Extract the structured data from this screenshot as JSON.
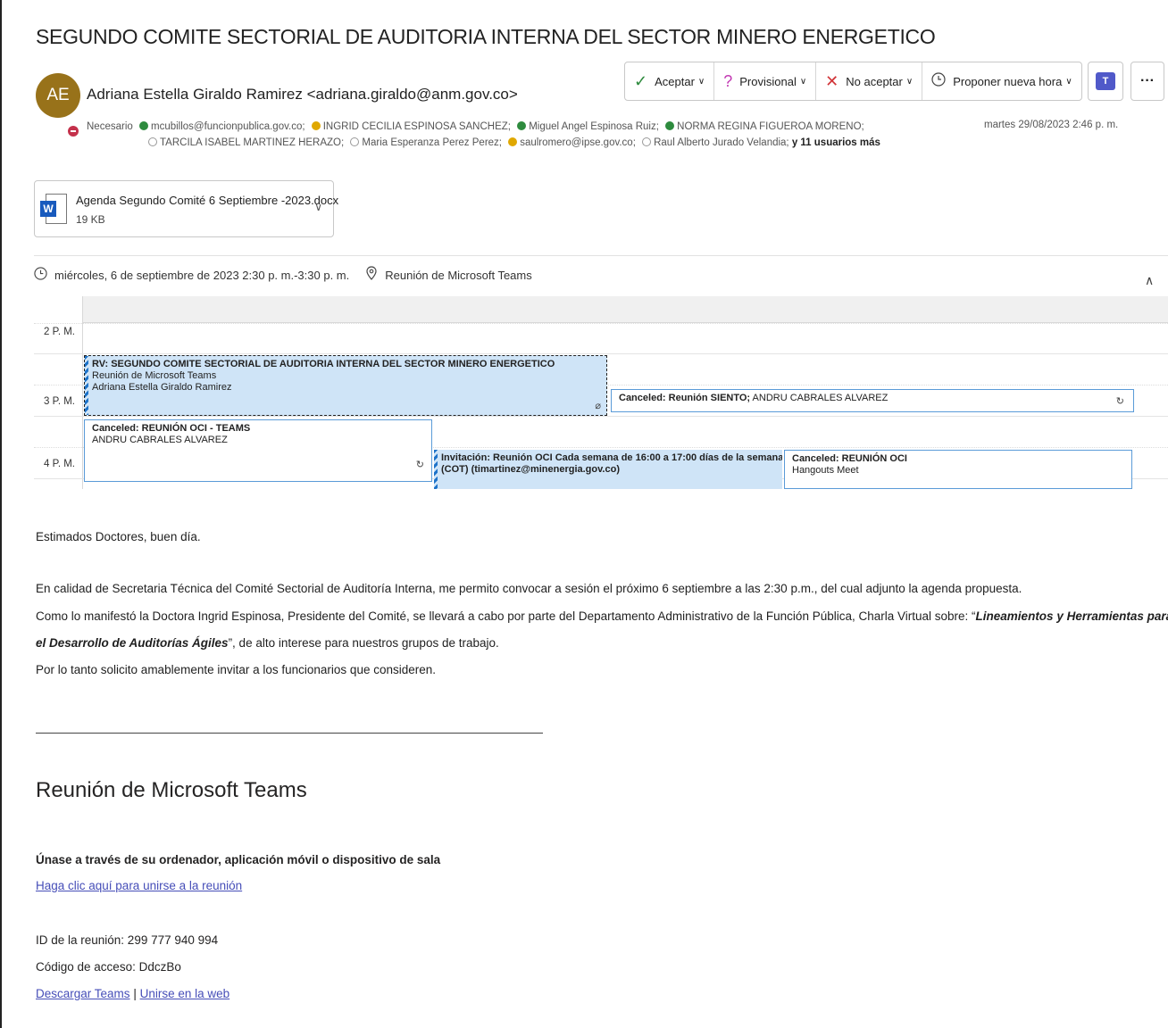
{
  "subject": "SEGUNDO COMITE SECTORIAL DE AUDITORIA INTERNA DEL SECTOR MINERO ENERGETICO",
  "sender": {
    "initials": "AE",
    "display": "Adriana Estella Giraldo Ramirez <adriana.giraldo@anm.gov.co>"
  },
  "toolbar": {
    "accept": "Aceptar",
    "tentative": "Provisional",
    "decline": "No aceptar",
    "propose": "Proponer nueva hora",
    "more": "···"
  },
  "recipients": {
    "label": "Necesario",
    "line1": [
      {
        "status": "accepted",
        "name": "mcubillos@funcionpublica.gov.co;"
      },
      {
        "status": "tentative",
        "name": "INGRID CECILIA ESPINOSA SANCHEZ;"
      },
      {
        "status": "accepted",
        "name": "Miguel Angel Espinosa Ruiz;"
      },
      {
        "status": "accepted",
        "name": "NORMA REGINA FIGUEROA MORENO;"
      }
    ],
    "line2": [
      {
        "status": "none",
        "name": "TARCILA ISABEL MARTINEZ HERAZO;"
      },
      {
        "status": "none",
        "name": "Maria Esperanza Perez Perez;"
      },
      {
        "status": "tentative",
        "name": "saulromero@ipse.gov.co;"
      },
      {
        "status": "none",
        "name": "Raul Alberto Jurado Velandia;"
      }
    ],
    "more": "y 11 usuarios más"
  },
  "sent_date": "martes 29/08/2023 2:46 p. m.",
  "attachment": {
    "name": "Agenda Segundo Comité 6 Septiembre -2023.docx",
    "size": "19 KB"
  },
  "meeting": {
    "when": "miércoles, 6 de septiembre de 2023 2:30 p. m.-3:30 p. m.",
    "where": "Reunión de Microsoft Teams"
  },
  "calendar": {
    "hours": [
      "2 P. M.",
      "3 P. M.",
      "4 P. M."
    ],
    "events": {
      "main": {
        "title": "RV: SEGUNDO COMITE SECTORIAL DE AUDITORIA INTERNA DEL SECTOR MINERO ENERGETICO",
        "line2": "Reunión de Microsoft Teams",
        "line3": "Adriana Estella Giraldo Ramirez"
      },
      "canceled1": {
        "title": "Canceled: Reunión SIENTO;",
        "rest": " ANDRU CABRALES ALVAREZ"
      },
      "canceled2": {
        "title": "Canceled: REUNIÓN OCI - TEAMS",
        "line2": "ANDRU CABRALES ALVAREZ"
      },
      "invitation": {
        "title": "Invitación: Reunión OCI Cada semana de 16:00 a 17:00 días de la semana",
        "line2": "(COT) (timartinez@minenergia.gov.co)"
      },
      "canceled3": {
        "title": "Canceled: REUNIÓN OCI",
        "line2": "Hangouts Meet"
      }
    }
  },
  "body": {
    "greeting": "Estimados Doctores, buen día.",
    "p1": "En calidad de Secretaria Técnica del  Comité Sectorial de Auditoría Interna, me permito convocar a sesión el próximo 6 septiembre a las 2:30 p.m., del cual adjunto la agenda propuesta.",
    "p2a": "Como lo manifestó la Doctora Ingrid Espinosa, Presidente del Comité, se llevará a cabo por parte del Departamento Administrativo de la Función Pública, Charla Virtual sobre: “",
    "p2b": "Lineamientos y Herramientas para",
    "p3a": "el Desarrollo de Auditorías Ágiles",
    "p3b": "”, de alto interese para nuestros grupos de trabajo.",
    "p4": "Por lo tanto solicito amablemente invitar a los funcionarios que consideren."
  },
  "teams": {
    "title": "Reunión de Microsoft Teams",
    "join_heading": "Únase a través de su ordenador, aplicación móvil o dispositivo de sala",
    "join_link": "Haga clic aquí para unirse a la reunión",
    "meeting_id": "ID de la reunión: 299 777 940 994",
    "passcode": "Código de acceso: DdczBo",
    "download": "Descargar Teams",
    "separator": "|",
    "web": "Unirse en la web"
  }
}
